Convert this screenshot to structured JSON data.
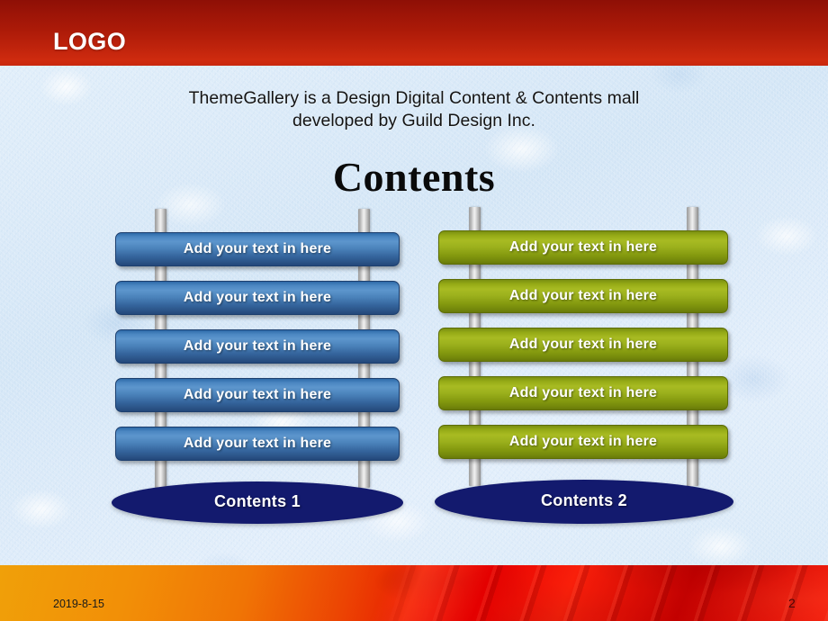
{
  "header": {
    "logo_label": "LOGO",
    "bar_color_top": "#8e0f06",
    "bar_color_bottom": "#cf2b0f"
  },
  "subtitle": {
    "line1": "ThemeGallery is a Design Digital Content & Contents mall",
    "line2": "developed by Guild Design Inc."
  },
  "title": {
    "text": "Contents"
  },
  "columns": [
    {
      "id": "left",
      "accent_color": "#4a82ba",
      "base_color": "#131a6e",
      "base_label": "Contents 1",
      "boards": [
        {
          "label": "Add your text in here"
        },
        {
          "label": "Add your text in here"
        },
        {
          "label": "Add your text in here"
        },
        {
          "label": "Add your text in here"
        },
        {
          "label": "Add your text in here"
        }
      ]
    },
    {
      "id": "right",
      "accent_color": "#9cb11d",
      "base_color": "#131a6e",
      "base_label": "Contents 2",
      "boards": [
        {
          "label": "Add your text in here"
        },
        {
          "label": "Add your text in here"
        },
        {
          "label": "Add your text in here"
        },
        {
          "label": "Add your text in here"
        },
        {
          "label": "Add your text in here"
        }
      ]
    }
  ],
  "footer": {
    "date": "2019-8-15",
    "slide_number": "2"
  }
}
